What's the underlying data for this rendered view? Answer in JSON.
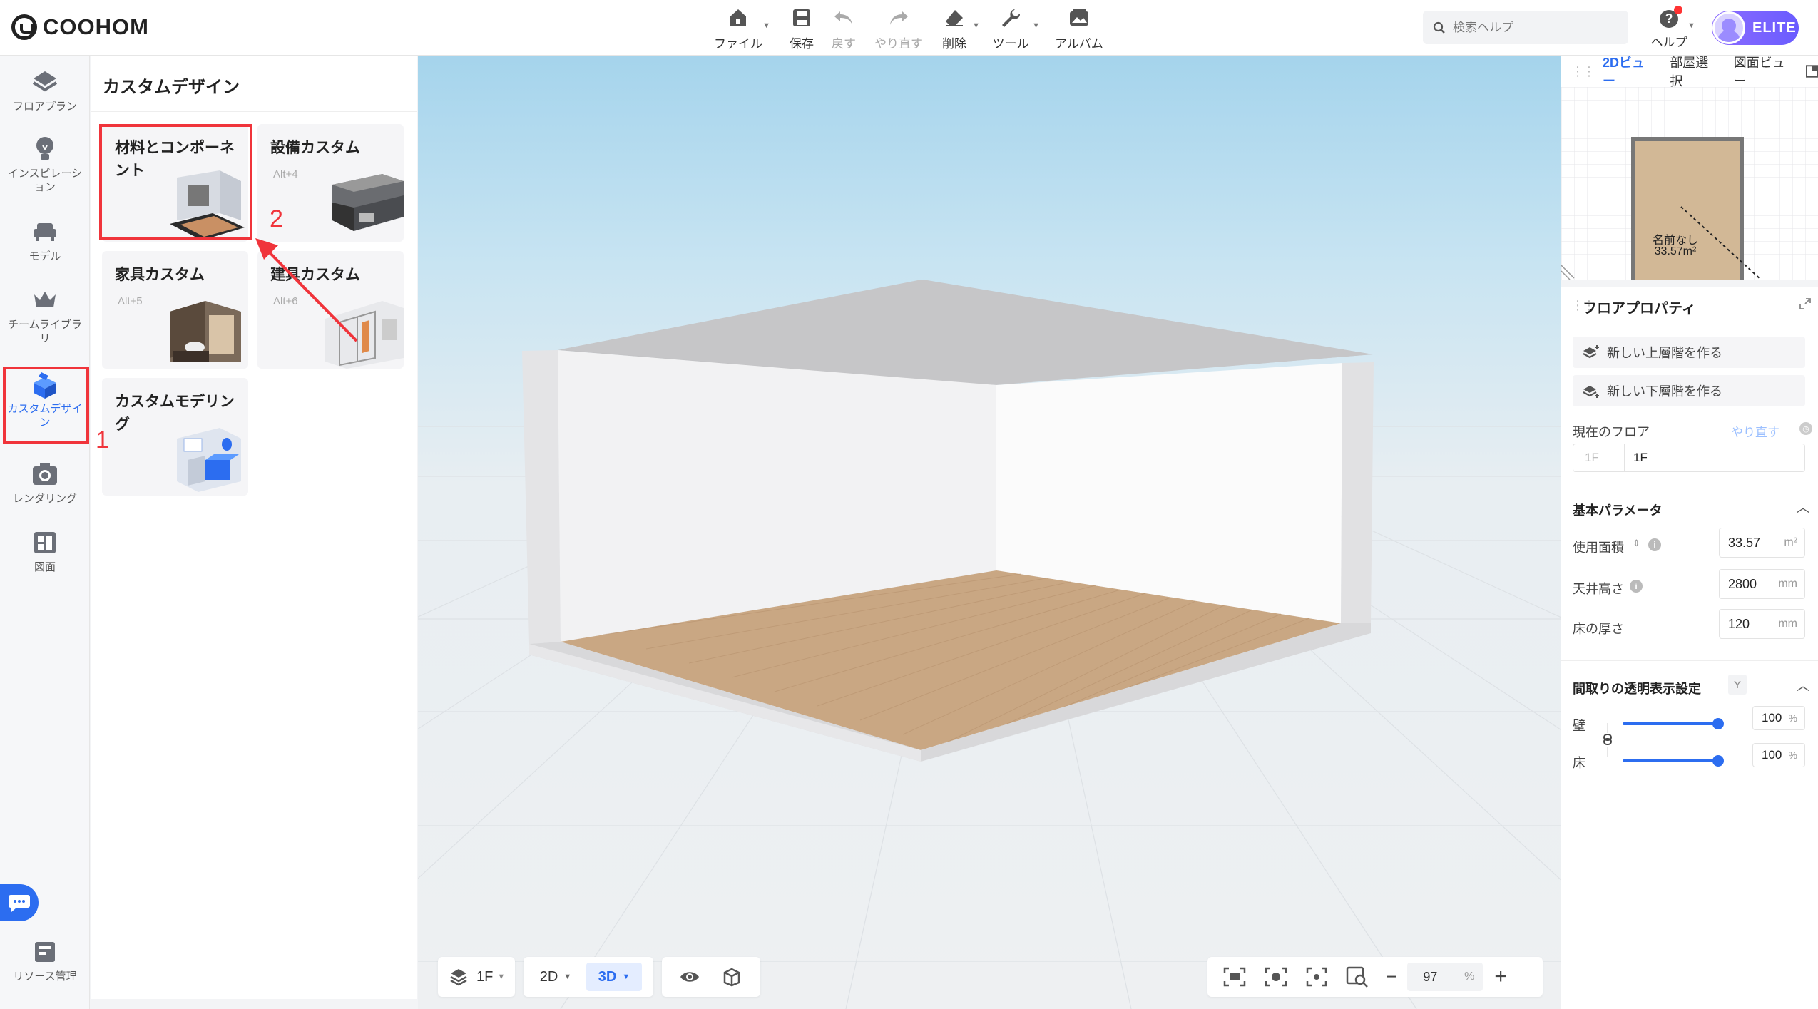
{
  "app": {
    "logo": "COOHOM"
  },
  "toolbar": {
    "file": "ファイル",
    "save": "保存",
    "undo": "戻す",
    "redo": "やり直す",
    "delete": "削除",
    "tools": "ツール",
    "album": "アルバム"
  },
  "search": {
    "placeholder": "検索ヘルプ"
  },
  "help": {
    "label": "ヘルプ"
  },
  "account": {
    "badge": "ELITE"
  },
  "rail": {
    "floorplan": "フロアプラン",
    "inspiration": "インスピレーション",
    "model": "モデル",
    "team_library": "チームライブラリ",
    "custom_design": "カスタムデザイン",
    "rendering": "レンダリング",
    "drawing": "図面",
    "resource": "リソース管理"
  },
  "annotations": {
    "step1": "1",
    "step2": "2"
  },
  "panel": {
    "title": "カスタムデザイン",
    "cards": [
      {
        "title": "材料とコンポーネント",
        "shortcut": ""
      },
      {
        "title": "設備カスタム",
        "shortcut": "Alt+4"
      },
      {
        "title": "家具カスタム",
        "shortcut": "Alt+5"
      },
      {
        "title": "建具カスタム",
        "shortcut": "Alt+6"
      },
      {
        "title": "カスタムモデリング",
        "shortcut": ""
      }
    ]
  },
  "viewport": {
    "floor": "1F",
    "view2d": "2D",
    "view3d": "3D",
    "zoom": "97",
    "zoom_unit": "%"
  },
  "minimap": {
    "tabs": [
      "2Dビュー",
      "部屋選択",
      "図面ビュー"
    ],
    "room_name": "名前なし",
    "room_area": "33.57m²"
  },
  "props": {
    "title": "フロアプロパティ",
    "new_upper": "新しい上層階を作る",
    "new_lower": "新しい下層階を作る",
    "current_floor": "現在のフロア",
    "redo": "やり直す",
    "floor_code": "1F",
    "floor_name": "1F",
    "basic_params": "基本パラメータ",
    "area_label": "使用面積",
    "area_value": "33.57",
    "area_unit": "m²",
    "ceiling_label": "天井高さ",
    "ceiling_value": "2800",
    "ceiling_unit": "mm",
    "floor_thick_label": "床の厚さ",
    "floor_thick_value": "120",
    "floor_thick_unit": "mm",
    "transparency": "間取りの透明表示設定",
    "shortcut_y": "Y",
    "wall_label": "壁",
    "wall_value": "100",
    "floor_label": "床",
    "floor_value": "100",
    "pct": "%"
  },
  "colors": {
    "accent": "#2c6df0",
    "highlight": "#f0343b"
  }
}
